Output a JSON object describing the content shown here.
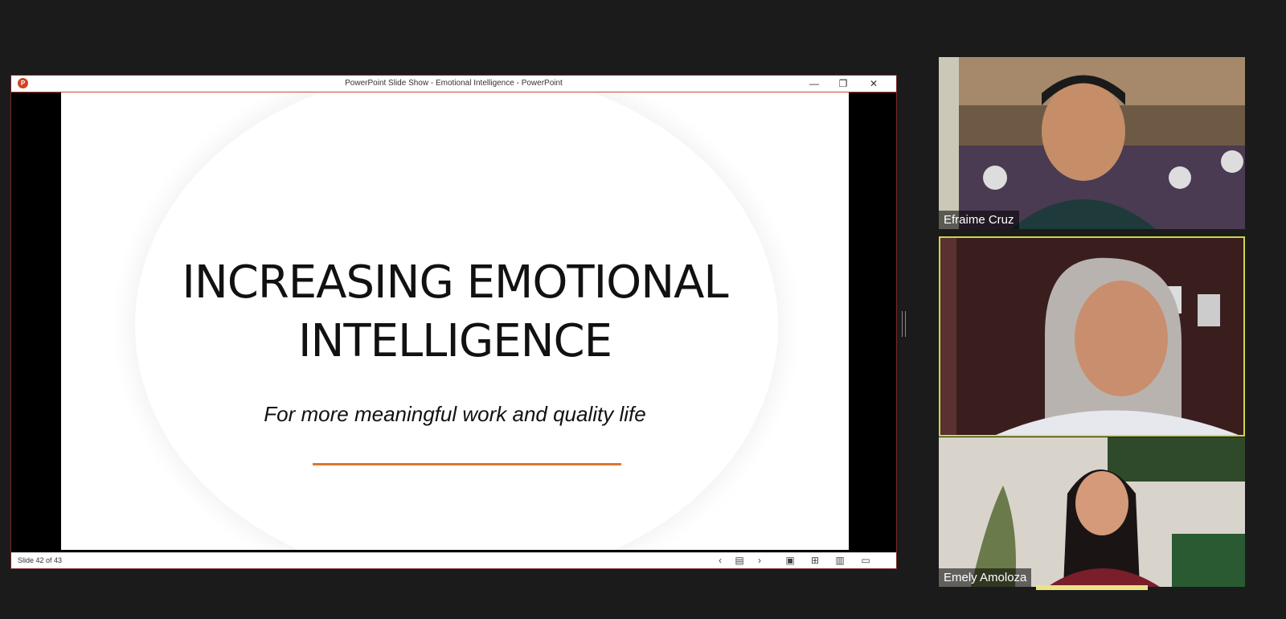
{
  "ppt": {
    "window_title": "PowerPoint Slide Show  -  Emotional Intelligence - PowerPoint",
    "logo": "P",
    "minimize_icon": "—",
    "restore_icon": "❐",
    "close_icon": "✕",
    "slide": {
      "title": "INCREASING EMOTIONAL INTELLIGENCE",
      "subtitle": "For more meaningful work and quality life",
      "accent_color": "#d9782f"
    },
    "status": {
      "slide_count": "Slide 42 of 43",
      "prev_icon": "‹",
      "see_all_icon": "▤",
      "next_icon": "›",
      "normal_view_icon": "▣",
      "sorter_view_icon": "⊞",
      "reading_view_icon": "▥",
      "slideshow_view_icon": "▭"
    }
  },
  "participants": [
    {
      "name": "Efraime Cruz"
    },
    {
      "name": ""
    },
    {
      "name": "Emely Amoloza"
    }
  ]
}
